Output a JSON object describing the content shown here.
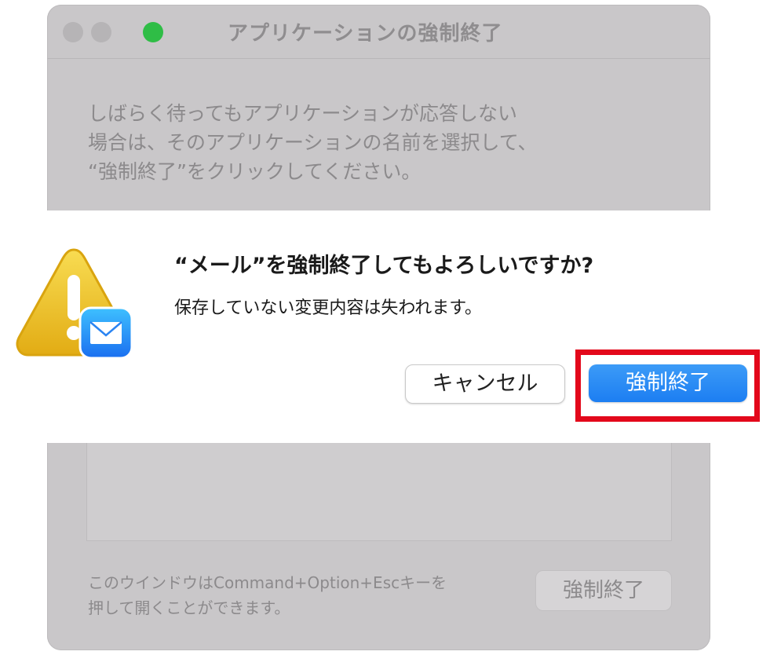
{
  "window": {
    "title": "アプリケーションの強制終了",
    "description_lines": [
      "しばらく待ってもアプリケーションが応答しない",
      "場合は、そのアプリケーションの名前を選択して、",
      "“強制終了”をクリックしてください。"
    ],
    "hint_lines": [
      "このウインドウはCommand+Option+Escキーを",
      "押して開くことができます。"
    ],
    "force_quit_label": "強制終了"
  },
  "alert": {
    "title": "“メール”を強制終了してもよろしいですか?",
    "message": "保存していない変更内容は失われます。",
    "cancel_label": "キャンセル",
    "force_quit_label": "強制終了",
    "icons": [
      "warning-icon",
      "mail-icon"
    ]
  },
  "colors": {
    "accent": "#1c7ef2",
    "highlight": "#e3081b",
    "zoom_button": "#2fbd46"
  }
}
